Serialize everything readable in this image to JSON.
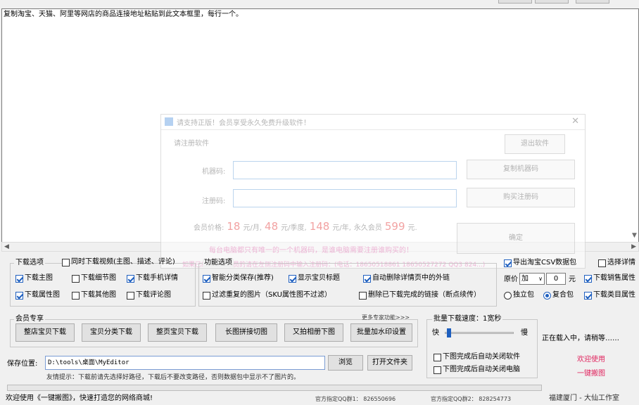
{
  "textarea": {
    "content": "复制淘宝、天猫、阿里等网店的商品连接地址粘贴到此文本框里，每行一个。"
  },
  "dialog": {
    "title": "请支持正版！会员享受永久免费升级软件！",
    "section": "请注册软件",
    "exit_button": "退出软件",
    "machine_label": "机器码:",
    "copy_machine_button": "复制机器码",
    "reg_label": "注册码:",
    "buy_button": "购买注册码",
    "price_label": "会员价格:",
    "price_month": "18",
    "unit_month": "元/月,",
    "price_quarter": "48",
    "unit_quarter": "元/季度,",
    "price_year": "148",
    "unit_year": "元/年,",
    "lifetime_label": "永久会员",
    "price_lifetime": "599",
    "unit_lifetime": "元.",
    "confirm_button": "确定",
    "note1": "每台电脑都只有唯一的一个机器码，是谁电脑需要注册谁购买的！",
    "note2": "如果已经购买过会员的请在左侧注册码中输入注册码：(电话：18650518861 18650527272 QQ3 824...)"
  },
  "download_options": {
    "legend": "下载选项",
    "sync_video": "同时下载视频(主图、描述、评论)",
    "main_img": "下载主图",
    "detail_img": "下载细节图",
    "mobile_detail": "下载手机详情",
    "attr_img": "下载属性图",
    "other_img": "下载其他图",
    "comment_img": "下载评论图"
  },
  "functions": {
    "legend": "功能选项",
    "smart_save": "智能分类保存(推荐)",
    "show_title": "显示宝贝标题",
    "auto_del_link": "自动删除详情页中的外链",
    "filter_dup": "过滤重复的图片（SKU属性图不过滤）",
    "del_downloaded": "删除已下载完成的链接（断点续传）"
  },
  "csv": {
    "export": "导出淘宝CSV数据包",
    "detail": "选择详情",
    "price_label": "原价",
    "op": "加",
    "op_value": "0",
    "unit": "元",
    "dl_sales": "下载销售属性",
    "independent": "独立包",
    "composite": "复合包",
    "dl_category": "下载类目属性"
  },
  "vip": {
    "legend": "会员专享",
    "more": "更多专家功能>>>",
    "shop_all": "整店宝贝下载",
    "category": "宝贝分类下载",
    "page_dl": "整页宝贝下载",
    "long_slice": "长图拼接切图",
    "yupoo": "又拍相册下图",
    "watermark": "批量加水印设置"
  },
  "speed": {
    "legend": "批量下载速度：1宽秒",
    "fast": "快",
    "slow": "慢",
    "slider_fraction": 0.02,
    "close_app": "下图完成后自动关闭软件",
    "shutdown": "下图完成后自动关闭电脑"
  },
  "save": {
    "label": "保存位置:",
    "path": "D:\\tools\\桌面\\MyEditor",
    "browse": "浏览",
    "open_folder": "打开文件夹",
    "tip": "友情提示：下载前请先选择好路径，下载后不要改变路径，否则数据包中显示不了图片的。"
  },
  "status": {
    "loading": "正在载入中，请稍等……",
    "welcome_red": "欢迎使用",
    "welcome_red2": "一键搬图",
    "footer_left": "欢迎使用《一键搬图》，快速打造您的网络商城!",
    "qq1": "官方指定QQ群1：  826550696",
    "qq2": "官方指定QQ群2：  828254773",
    "studio": "福建厦门 - 大仙工作室"
  },
  "colors": {
    "accent": "#1e5fbf",
    "brand_red": "#e0245e"
  }
}
